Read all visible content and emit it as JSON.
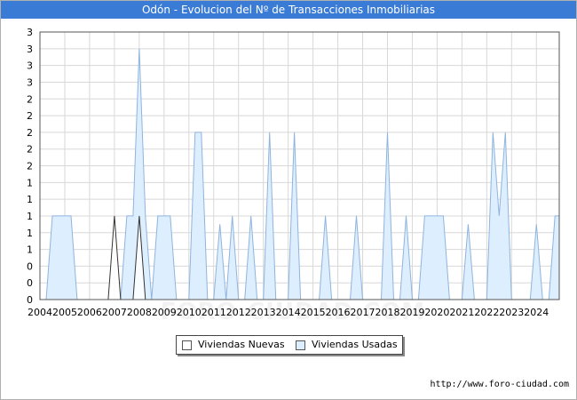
{
  "title": "Odón - Evolucion del Nº de Transacciones Inmobiliarias",
  "source": "http://www.foro-ciudad.com",
  "watermark": "FORO-CIUDAD.COM",
  "colors": {
    "title_bg": "#3a7bd5",
    "nuevas_fill": "#ffffff",
    "nuevas_line": "#333333",
    "usadas_fill": "#ddeeff",
    "usadas_line": "#8fb4dd",
    "grid": "#d8d8d8"
  },
  "legend": {
    "nuevas": "Viviendas Nuevas",
    "usadas": "Viviendas Usadas"
  },
  "chart_data": {
    "type": "area",
    "xlabel": "",
    "ylabel": "",
    "ylim": [
      0,
      3.2
    ],
    "xlim": [
      2004.0,
      2024.92
    ],
    "grid": true,
    "legend_position": "bottom",
    "y_ticks": [
      0,
      0.2,
      0.4,
      0.6,
      0.8,
      1.0,
      1.2,
      1.4,
      1.6,
      1.8,
      2.0,
      2.2,
      2.4,
      2.6,
      2.8,
      3.0,
      3.2
    ],
    "y_tick_labels": [
      "0",
      "0",
      "0",
      "1",
      "1",
      "1",
      "1",
      "1",
      "2",
      "2",
      "2",
      "2",
      "2",
      "3",
      "3",
      "3",
      "3"
    ],
    "x_ticks": [
      2004,
      2005,
      2006,
      2007,
      2008,
      2009,
      2010,
      2011,
      2012,
      2013,
      2014,
      2015,
      2016,
      2017,
      2018,
      2019,
      2020,
      2021,
      2022,
      2023,
      2024
    ],
    "x_tick_labels": [
      "2004",
      "2005",
      "2006",
      "2007",
      "2008",
      "2009",
      "2010",
      "2011",
      "2012",
      "2013",
      "2014",
      "2015",
      "2016",
      "2017",
      "2018",
      "2019",
      "2020",
      "2021",
      "2022",
      "2023",
      "2024"
    ],
    "series": [
      {
        "name": "Viviendas Usadas",
        "points": [
          [
            2004.25,
            0
          ],
          [
            2004.5,
            1
          ],
          [
            2005.25,
            1
          ],
          [
            2005.5,
            0
          ],
          [
            2007.25,
            0
          ],
          [
            2007.5,
            1
          ],
          [
            2007.75,
            1
          ],
          [
            2008.0,
            3
          ],
          [
            2008.25,
            1
          ],
          [
            2008.5,
            0
          ],
          [
            2008.5,
            0
          ],
          [
            2008.75,
            1
          ],
          [
            2009.25,
            1
          ],
          [
            2009.5,
            0
          ],
          [
            2010.0,
            0
          ],
          [
            2010.25,
            2
          ],
          [
            2010.5,
            2
          ],
          [
            2010.75,
            0
          ],
          [
            2011.0,
            0
          ],
          [
            2011.25,
            0.9
          ],
          [
            2011.5,
            0
          ],
          [
            2011.5,
            0
          ],
          [
            2011.75,
            1
          ],
          [
            2012.0,
            0
          ],
          [
            2012.25,
            0
          ],
          [
            2012.5,
            1
          ],
          [
            2012.75,
            0
          ],
          [
            2013.0,
            0
          ],
          [
            2013.25,
            2
          ],
          [
            2013.5,
            0
          ],
          [
            2014.0,
            0
          ],
          [
            2014.25,
            2
          ],
          [
            2014.5,
            0
          ],
          [
            2015.25,
            0
          ],
          [
            2015.5,
            1
          ],
          [
            2015.75,
            0
          ],
          [
            2016.5,
            0
          ],
          [
            2016.75,
            1
          ],
          [
            2017.0,
            0
          ],
          [
            2017.75,
            0
          ],
          [
            2018.0,
            2
          ],
          [
            2018.25,
            0
          ],
          [
            2018.5,
            0
          ],
          [
            2018.75,
            1
          ],
          [
            2019.0,
            0
          ],
          [
            2019.25,
            0
          ],
          [
            2019.5,
            1
          ],
          [
            2020.25,
            1
          ],
          [
            2020.5,
            0
          ],
          [
            2021.0,
            0
          ],
          [
            2021.25,
            0.9
          ],
          [
            2021.5,
            0
          ],
          [
            2022.0,
            0
          ],
          [
            2022.25,
            2
          ],
          [
            2022.5,
            1
          ],
          [
            2022.75,
            2
          ],
          [
            2023.0,
            0
          ],
          [
            2023.75,
            0
          ],
          [
            2024.0,
            0.9
          ],
          [
            2024.25,
            0
          ],
          [
            2024.5,
            0
          ],
          [
            2024.75,
            1
          ],
          [
            2024.92,
            1
          ]
        ]
      },
      {
        "name": "Viviendas Nuevas",
        "points": [
          [
            2006.75,
            0
          ],
          [
            2007.0,
            1
          ],
          [
            2007.25,
            0
          ],
          [
            2007.75,
            0
          ],
          [
            2008.0,
            1
          ],
          [
            2008.25,
            0
          ]
        ]
      }
    ]
  }
}
